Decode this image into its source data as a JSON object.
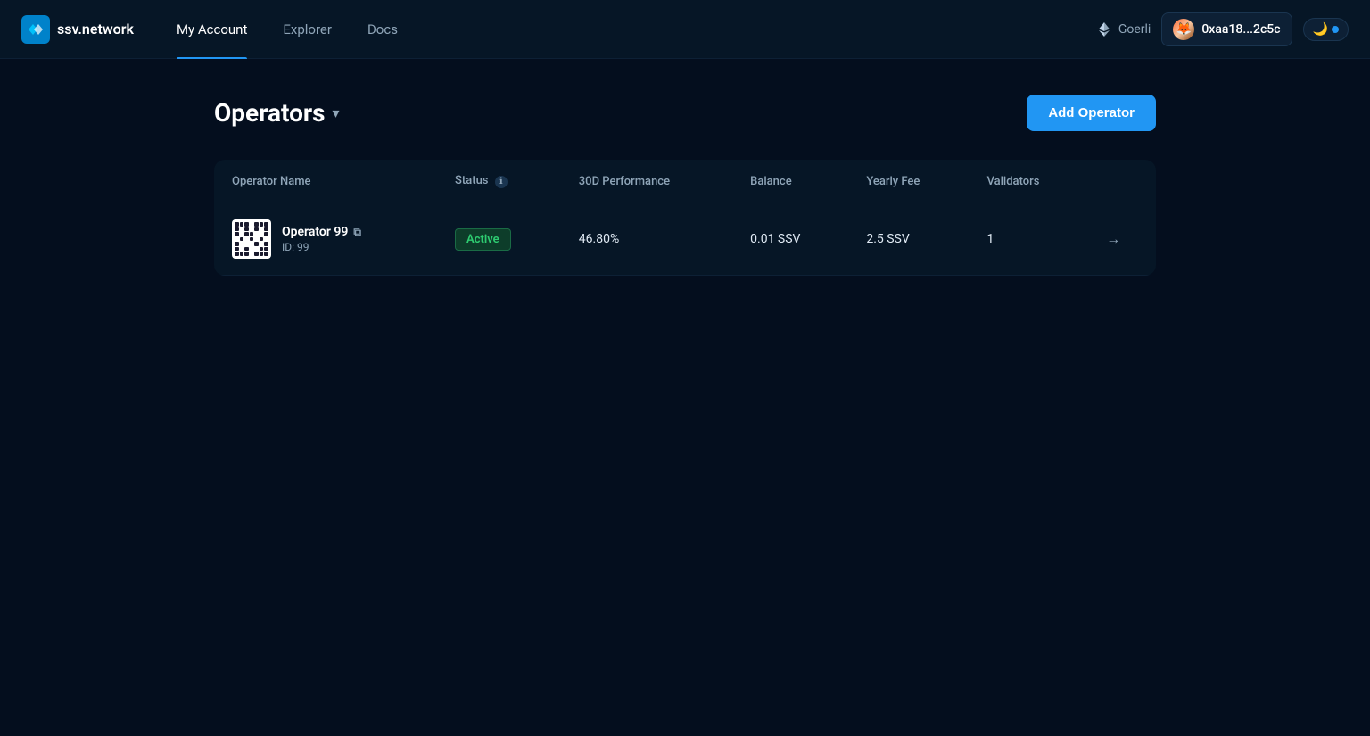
{
  "header": {
    "logo_text": "ssv.network",
    "nav_items": [
      {
        "label": "My Account",
        "active": true
      },
      {
        "label": "Explorer",
        "active": false
      },
      {
        "label": "Docs",
        "active": false
      }
    ],
    "network_label": "Goerli",
    "wallet_address": "0xaa18...2c5c",
    "theme_icon": "🌙"
  },
  "page": {
    "title": "Operators",
    "add_button_label": "Add Operator"
  },
  "table": {
    "columns": [
      {
        "key": "name",
        "label": "Operator Name"
      },
      {
        "key": "status",
        "label": "Status",
        "has_info": true
      },
      {
        "key": "performance",
        "label": "30D Performance"
      },
      {
        "key": "balance",
        "label": "Balance"
      },
      {
        "key": "yearly_fee",
        "label": "Yearly Fee"
      },
      {
        "key": "validators",
        "label": "Validators"
      }
    ],
    "rows": [
      {
        "name": "Operator 99",
        "id": "ID: 99",
        "status": "Active",
        "performance": "46.80%",
        "balance": "0.01 SSV",
        "yearly_fee": "2.5 SSV",
        "validators": "1"
      }
    ]
  }
}
